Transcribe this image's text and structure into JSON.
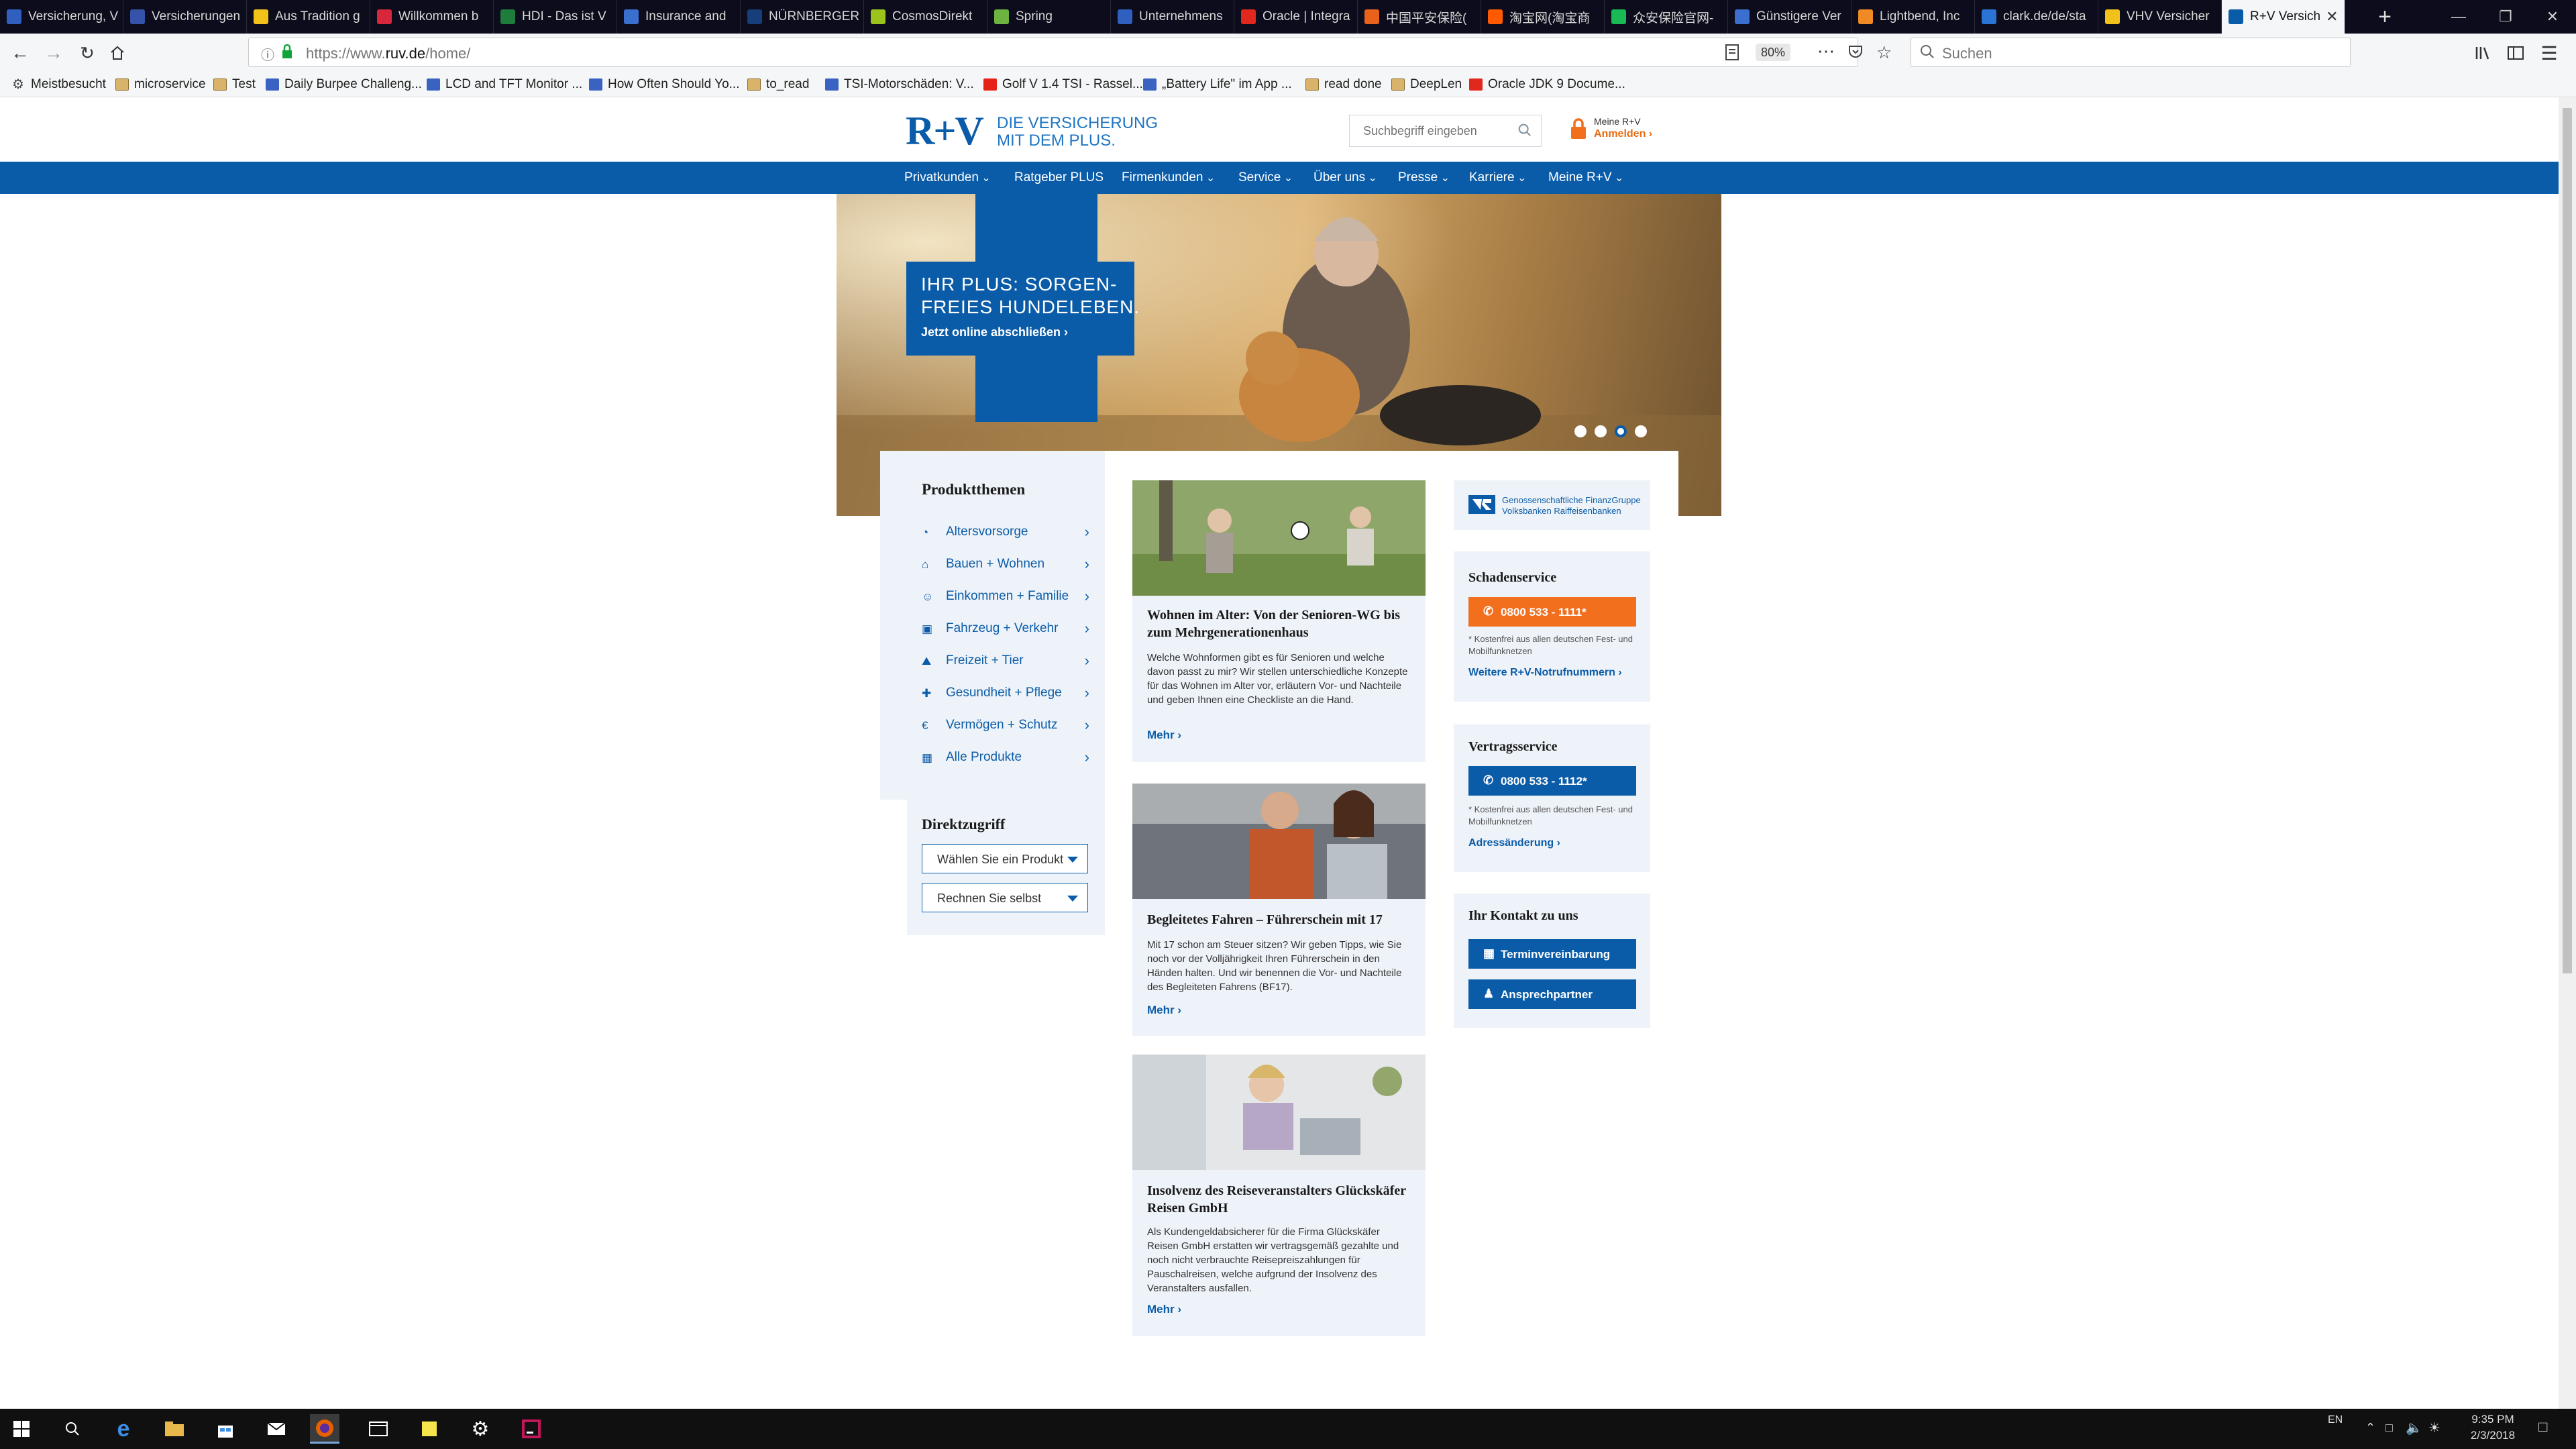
{
  "browser": {
    "tabs": [
      {
        "title": "Versicherung, V",
        "color": "#2f5fbf"
      },
      {
        "title": "Versicherungen",
        "color": "#3553a8"
      },
      {
        "title": "Aus Tradition g",
        "color": "#f2c21b"
      },
      {
        "title": "Willkommen b",
        "color": "#d8263b"
      },
      {
        "title": "HDI - Das ist V",
        "color": "#1e7d3c"
      },
      {
        "title": "Insurance and ",
        "color": "#3a6fd0"
      },
      {
        "title": "NÜRNBERGER",
        "color": "#153e7a"
      },
      {
        "title": "CosmosDirekt",
        "color": "#9bc31b"
      },
      {
        "title": "Spring",
        "color": "#6db33f"
      },
      {
        "title": "Unternehmens",
        "color": "#2f5fbf"
      },
      {
        "title": "Oracle | Integra",
        "color": "#e0281e"
      },
      {
        "title": "中国平安保险(",
        "color": "#e8621c"
      },
      {
        "title": "淘宝网(淘宝商",
        "color": "#ff5a00"
      },
      {
        "title": "众安保险官网-",
        "color": "#19b955"
      },
      {
        "title": "Günstigere Ver",
        "color": "#3a6fd0"
      },
      {
        "title": "Lightbend, Inc",
        "color": "#f08a24"
      },
      {
        "title": "clark.de/de/sta",
        "color": "#2a74d6"
      },
      {
        "title": "VHV Versicher",
        "color": "#f2c21b"
      },
      {
        "title": "R+V Versich",
        "color": "#0b5ca8"
      }
    ],
    "url_prefix": "https://www.",
    "url_domain": "ruv.de",
    "url_path": "/home/",
    "zoom": "80%",
    "search_placeholder": "Suchen",
    "bookmarks": [
      {
        "label": "Meistbesucht",
        "icon": "gear-icon"
      },
      {
        "label": "microservice",
        "icon": "folder-icon"
      },
      {
        "label": "Test",
        "icon": "folder-icon"
      },
      {
        "label": "Daily Burpee Challeng...",
        "icon": "site-icon"
      },
      {
        "label": "LCD and TFT Monitor ...",
        "icon": "site-icon"
      },
      {
        "label": "How Often Should Yo...",
        "icon": "site-icon"
      },
      {
        "label": "to_read",
        "icon": "folder-icon"
      },
      {
        "label": "TSI-Motorschäden: V...",
        "icon": "site-icon"
      },
      {
        "label": "Golf V 1.4 TSI - Rassel...",
        "icon": "youtube-icon"
      },
      {
        "label": "„Battery Life\" im App ...",
        "icon": "site-icon"
      },
      {
        "label": "read done",
        "icon": "folder-icon"
      },
      {
        "label": "DeepLen",
        "icon": "folder-icon"
      },
      {
        "label": "Oracle JDK 9 Docume...",
        "icon": "oracle-icon"
      }
    ]
  },
  "site": {
    "logo": "R+V",
    "claim_line1": "DIE VERSICHERUNG",
    "claim_line2": "MIT DEM PLUS.",
    "search_placeholder": "Suchbegriff eingeben",
    "account_line1": "Meine R+V",
    "account_line2": "Anmelden ›",
    "nav": [
      "Privatkunden",
      "Ratgeber PLUS",
      "Firmenkunden",
      "Service",
      "Über uns",
      "Presse",
      "Karriere",
      "Meine R+V"
    ],
    "nav_dropdown": [
      true,
      false,
      true,
      true,
      true,
      true,
      true,
      true
    ]
  },
  "hero": {
    "title_line1": "IHR PLUS: SORGEN-",
    "title_line2": "FREIES HUNDELEBEN.",
    "cta": "Jetzt online abschließen ›",
    "slides": 4,
    "active_slide": 3
  },
  "produktthemen": {
    "heading": "Produktthemen",
    "items": [
      {
        "label": "Altersvorsorge",
        "icon": "pie-chart-icon"
      },
      {
        "label": "Bauen + Wohnen",
        "icon": "house-icon"
      },
      {
        "label": "Einkommen + Familie",
        "icon": "family-icon"
      },
      {
        "label": "Fahrzeug + Verkehr",
        "icon": "car-icon"
      },
      {
        "label": "Freizeit + Tier",
        "icon": "hiker-icon"
      },
      {
        "label": "Gesundheit + Pflege",
        "icon": "medical-bag-icon"
      },
      {
        "label": "Vermögen + Schutz",
        "icon": "euro-icon"
      },
      {
        "label": "Alle Produkte",
        "icon": "grid-icon"
      }
    ]
  },
  "direktzugriff": {
    "heading": "Direktzugriff",
    "select1": "Wählen Sie ein Produkt",
    "select2": "Rechnen Sie selbst"
  },
  "articles": [
    {
      "title": "Wohnen im Alter: Von der Senioren-WG bis zum Mehrgenerationenhaus",
      "text": "Welche Wohnformen gibt es für Senioren und welche davon passt zu mir? Wir stellen unterschiedliche Konzepte für das Wohnen im Alter vor, erläutern Vor- und Nachteile und geben Ihnen eine Checkliste an die Hand.",
      "more": "Mehr ›"
    },
    {
      "title": "Begleitetes Fahren – Führerschein mit 17",
      "text": "Mit 17 schon am Steuer sitzen? Wir geben Tipps, wie Sie noch vor der Volljährigkeit Ihren Führerschein in den Händen halten. Und wir benennen die Vor- und Nachteile des Begleiteten Fahrens (BF17).",
      "more": "Mehr ›"
    },
    {
      "title": "Insolvenz des Reiseveranstalters Glückskäfer Reisen GmbH",
      "text": "Als Kundengeldabsicherer für die Firma Glückskäfer Reisen GmbH erstatten wir vertragsgemäß gezahlte und noch nicht verbrauchte Reisepreiszahlungen für Pauschalreisen, welche aufgrund der Insolvenz des Veranstalters ausfallen.",
      "more": "Mehr ›"
    }
  ],
  "sidebar": {
    "partner_line1": "Genossenschaftliche FinanzGruppe",
    "partner_line2": "Volksbanken Raiffeisenbanken",
    "schaden_heading": "Schadenservice",
    "schaden_phone": "0800 533 - 1111*",
    "schaden_note": "* Kostenfrei aus allen deutschen Fest- und Mobilfunknetzen",
    "schaden_link": "Weitere R+V-Notrufnummern ›",
    "vertrag_heading": "Vertragsservice",
    "vertrag_phone": "0800 533 - 1112*",
    "vertrag_note": "* Kostenfrei aus allen deutschen Fest- und Mobilfunknetzen",
    "vertrag_link": "Adressänderung ›",
    "kontakt_heading": "Ihr Kontakt zu uns",
    "kontakt_btn1": "Terminvereinbarung",
    "kontakt_btn2": "Ansprechpartner"
  },
  "taskbar": {
    "lang": "EN",
    "time": "9:35 PM",
    "date": "2/3/2018"
  },
  "colors": {
    "brand_blue": "#0b5ca8",
    "accent_orange": "#f26f1e",
    "panel_bg": "#eef3f9"
  }
}
